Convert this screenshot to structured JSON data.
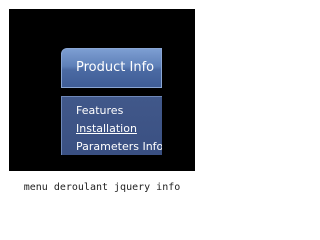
{
  "menu": {
    "header_label": "Product Info",
    "items": [
      {
        "label": "Features"
      },
      {
        "label": "Installation"
      },
      {
        "label": "Parameters Info"
      }
    ]
  },
  "caption": "menu deroulant jquery info",
  "colors": {
    "frame_background": "#000000",
    "header_gradient_top": "#7d9ed2",
    "header_gradient_bottom": "#3f5d96",
    "submenu_background": "#3a5082",
    "text": "#ffffff"
  }
}
